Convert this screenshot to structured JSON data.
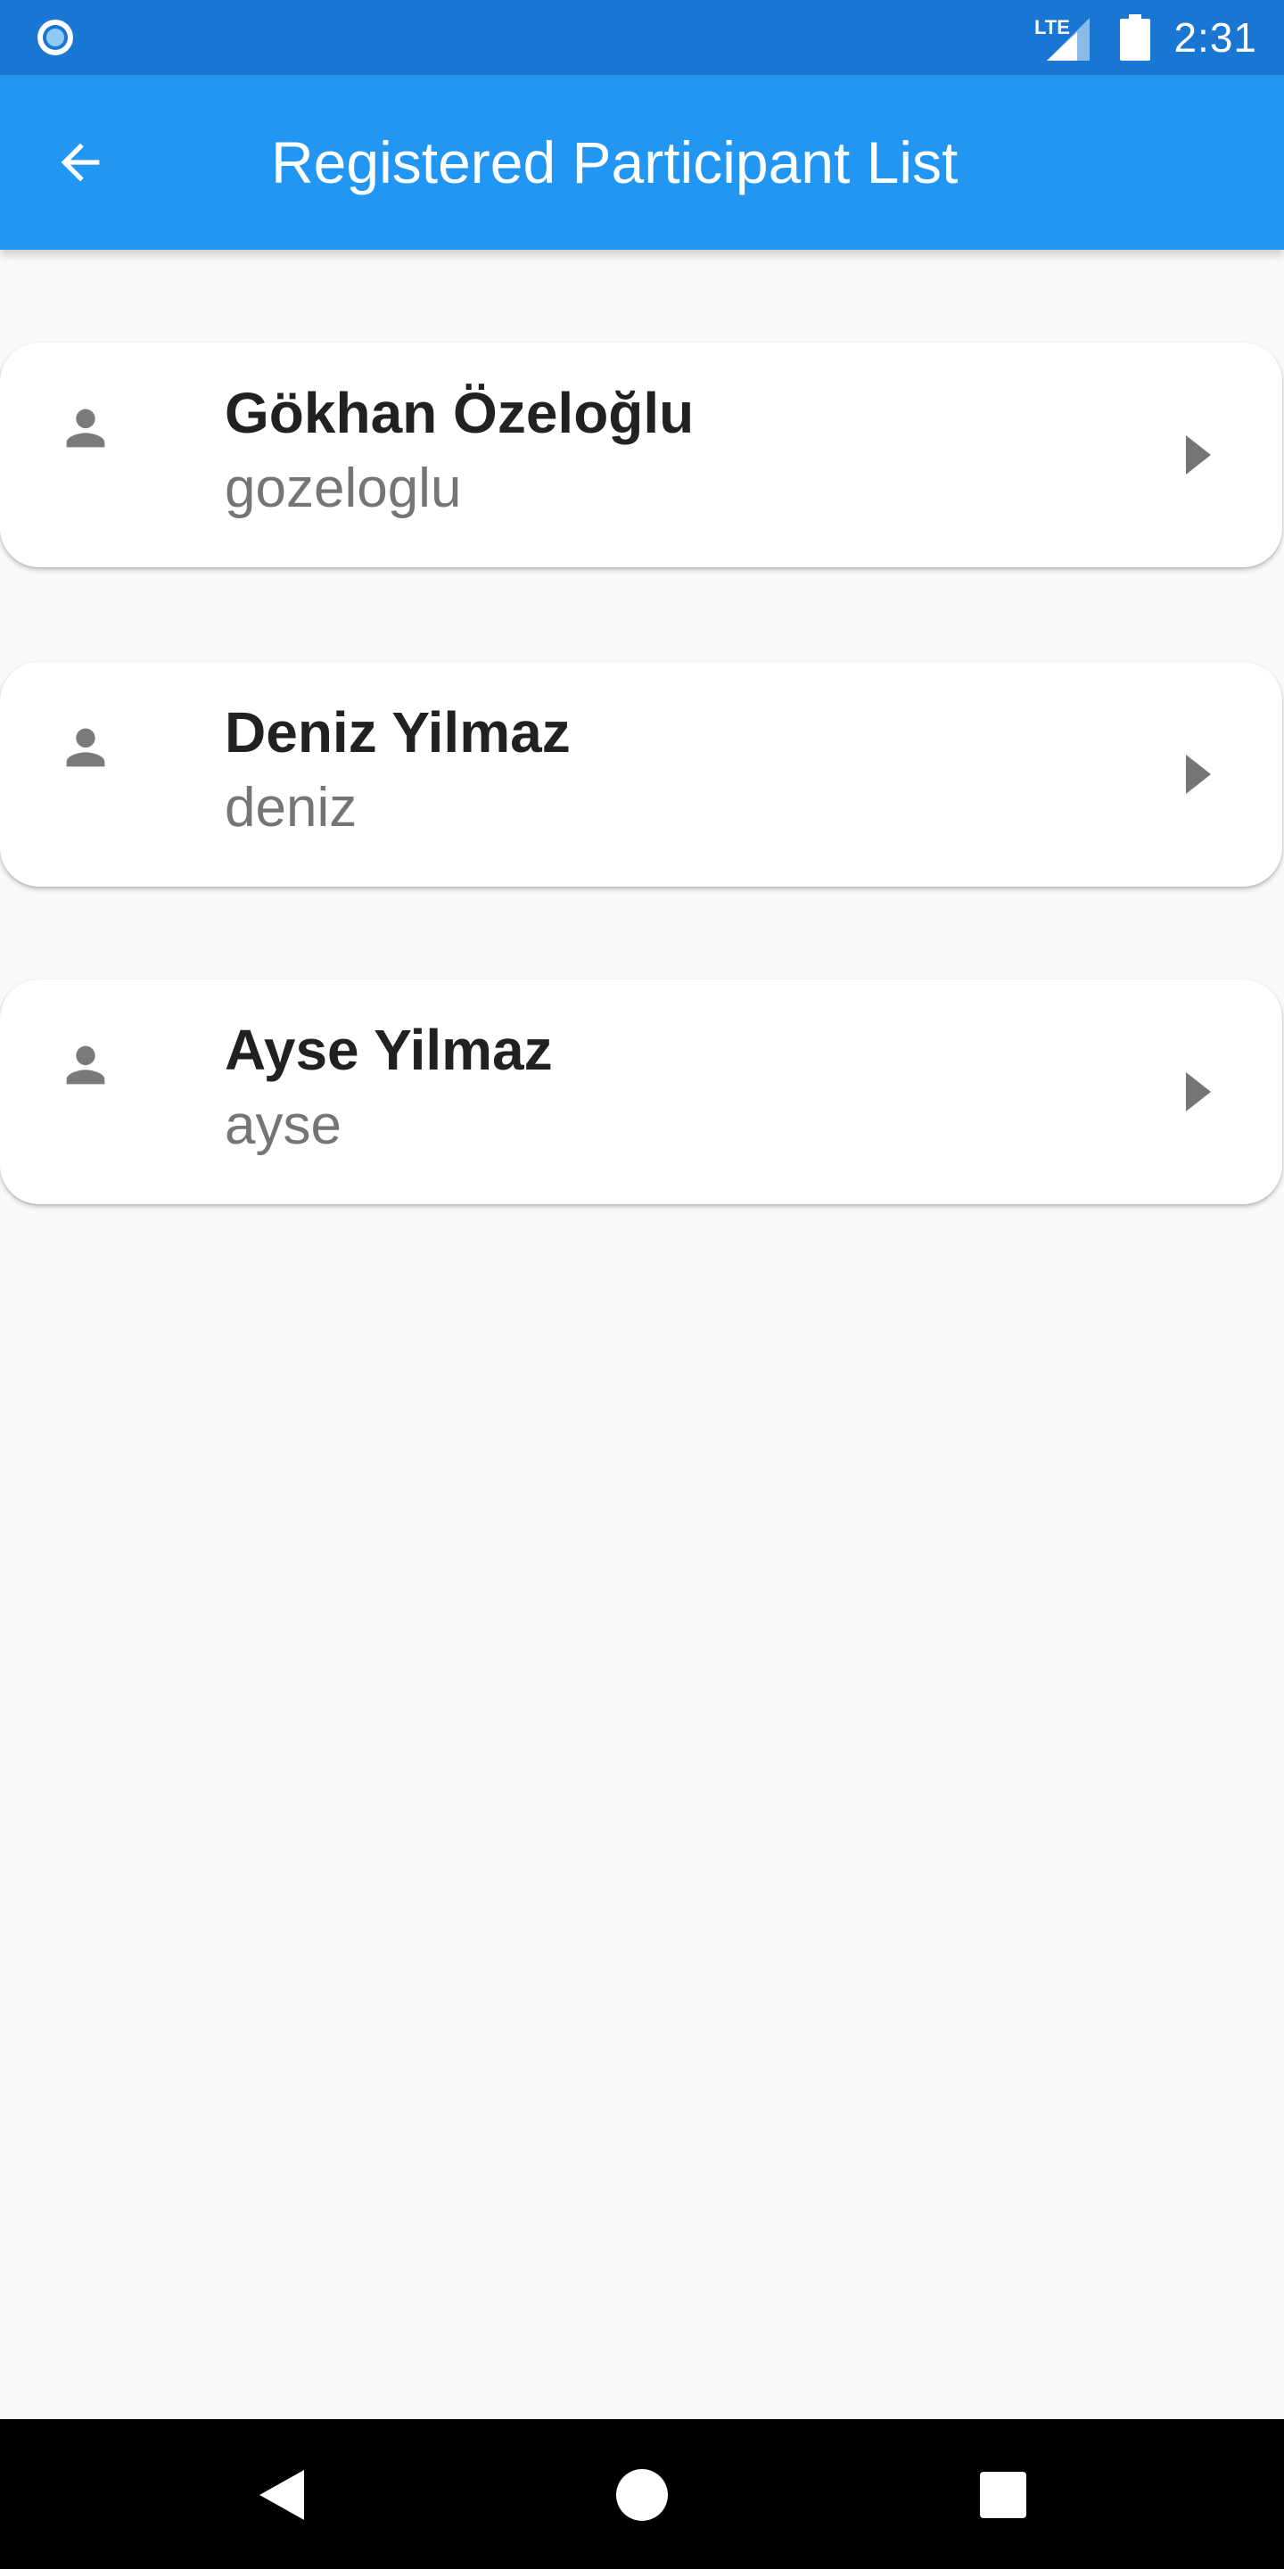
{
  "status_bar": {
    "time": "2:31",
    "network": "LTE",
    "icons": [
      "notification-circle-icon",
      "lte-signal-icon",
      "battery-icon"
    ]
  },
  "app_bar": {
    "title": "Registered Participant List",
    "back_icon": "arrow-back-icon"
  },
  "participants": [
    {
      "name": "Gökhan Özeloğlu",
      "username": "gozeloglu"
    },
    {
      "name": "Deniz Yilmaz",
      "username": "deniz"
    },
    {
      "name": "Ayse Yilmaz",
      "username": "ayse"
    }
  ],
  "nav_bar": {
    "buttons": [
      "back-triangle-icon",
      "home-circle-icon",
      "recents-square-icon"
    ]
  },
  "colors": {
    "status_bar": "#1976d2",
    "app_bar": "#2196f3",
    "background": "#fafafa",
    "card": "#ffffff",
    "name_text": "#212121",
    "username_text": "#757575",
    "icon_gray": "#7a7a7a"
  }
}
